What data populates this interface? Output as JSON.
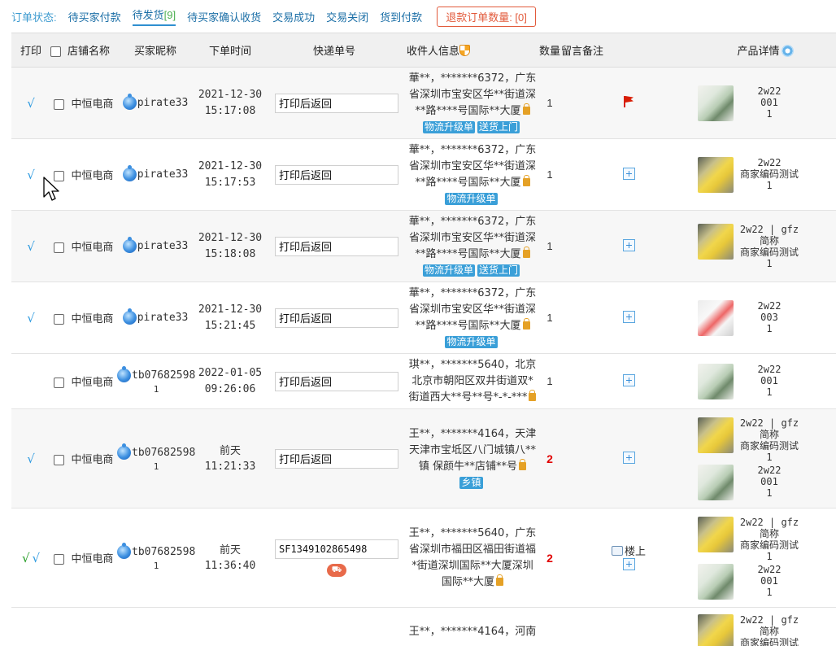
{
  "status_bar": {
    "label": "订单状态:",
    "tabs": [
      {
        "label": "待买家付款",
        "count": ""
      },
      {
        "label": "待发货",
        "count": "[9]"
      },
      {
        "label": "待买家确认收货",
        "count": ""
      },
      {
        "label": "交易成功",
        "count": ""
      },
      {
        "label": "交易关闭",
        "count": ""
      },
      {
        "label": "货到付款",
        "count": ""
      }
    ],
    "refund": "退款订单数量: [0]"
  },
  "columns": {
    "print": "打印",
    "shop": "店铺名称",
    "buyer": "买家昵称",
    "order_time": "下单时间",
    "tracking": "快递单号",
    "recipient": "收件人信息",
    "qty": "数量",
    "note": "留言备注",
    "product": "产品详情"
  },
  "icons": {
    "tick": "✓",
    "lock": "lock-icon",
    "flag": "flag-icon",
    "plus": "plus-icon",
    "memo": "memo-icon",
    "shield": "shield-icon",
    "gear": "gear-icon"
  },
  "colors": {
    "accent": "#2f8fd0",
    "tag_bg": "#3a9fd8",
    "refund": "#e25a3b",
    "qty_red": "#e10000"
  },
  "rows": [
    {
      "print_tick": "√",
      "print_tick2": "",
      "shop": "中恒电商",
      "buyer": "pirate33",
      "buyer_sfx": "",
      "date": "2021-12-30",
      "time": "15:17:08",
      "tracking": "打印后返回",
      "address": "華**，*******6372，广东省深圳市宝安区华**街道深**路****号国际**大厦",
      "tags": [
        "物流升级单",
        "送货上门"
      ],
      "qty": "1",
      "note_icon": "flag",
      "products": [
        {
          "thumb": "green",
          "name": "2w22",
          "code": "001",
          "qty": "1"
        }
      ]
    },
    {
      "print_tick": "√",
      "print_tick2": "",
      "shop": "中恒电商",
      "buyer": "pirate33",
      "buyer_sfx": "",
      "date": "2021-12-30",
      "time": "15:17:53",
      "tracking": "打印后返回",
      "address": "華**，*******6372，广东省深圳市宝安区华**街道深**路****号国际**大厦",
      "tags": [
        "物流升级单"
      ],
      "qty": "1",
      "note_icon": "plus",
      "products": [
        {
          "thumb": "yellow",
          "name": "2w22",
          "code": "商家编码测试",
          "qty": "1"
        }
      ]
    },
    {
      "print_tick": "√",
      "print_tick2": "",
      "shop": "中恒电商",
      "buyer": "pirate33",
      "buyer_sfx": "",
      "date": "2021-12-30",
      "time": "15:18:08",
      "tracking": "打印后返回",
      "address": "華**，*******6372，广东省深圳市宝安区华**街道深**路****号国际**大厦",
      "tags": [
        "物流升级单",
        "送货上门"
      ],
      "qty": "1",
      "note_icon": "plus",
      "products": [
        {
          "thumb": "yellow",
          "name": "2w22 | gfz简称",
          "code": "商家编码测试",
          "qty": "1"
        }
      ]
    },
    {
      "print_tick": "√",
      "print_tick2": "",
      "shop": "中恒电商",
      "buyer": "pirate33",
      "buyer_sfx": "",
      "date": "2021-12-30",
      "time": "15:21:45",
      "tracking": "打印后返回",
      "address": "華**，*******6372，广东省深圳市宝安区华**街道深**路****号国际**大厦",
      "tags": [
        "物流升级单"
      ],
      "qty": "1",
      "note_icon": "plus",
      "products": [
        {
          "thumb": "red",
          "name": "2w22",
          "code": "003",
          "qty": "1"
        }
      ]
    },
    {
      "print_tick": "",
      "print_tick2": "",
      "shop": "中恒电商",
      "buyer": "tb07682598",
      "buyer_sfx": "1",
      "date": "2022-01-05",
      "time": "09:26:06",
      "tracking": "打印后返回",
      "address": "琪**，*******5640，北京北京市朝阳区双井街道双*街道西大**号**号*-*-***",
      "tags": [],
      "qty": "1",
      "note_icon": "plus",
      "products": [
        {
          "thumb": "green",
          "name": "2w22",
          "code": "001",
          "qty": "1"
        }
      ]
    },
    {
      "print_tick": "√",
      "print_tick2": "",
      "shop": "中恒电商",
      "buyer": "tb07682598",
      "buyer_sfx": "1",
      "date": "前天",
      "time": "11:21:33",
      "tracking": "打印后返回",
      "address": "王**，*******4164，天津天津市宝坻区八门城镇八**镇 保颜牛**店铺**号",
      "tags": [
        "乡镇"
      ],
      "qty": "2",
      "note_icon": "plus",
      "products": [
        {
          "thumb": "yellow",
          "name": "2w22 | gfz简称",
          "code": "商家编码测试",
          "qty": "1"
        },
        {
          "thumb": "green",
          "name": "2w22",
          "code": "001",
          "qty": "1"
        }
      ]
    },
    {
      "print_tick": "√",
      "print_tick2": "√",
      "shop": "中恒电商",
      "buyer": "tb07682598",
      "buyer_sfx": "1",
      "date": "前天",
      "time": "11:36:40",
      "tracking": "SF1349102865498",
      "address": "王**，*******5640，广东省深圳市福田区福田街道福*街道深圳国际**大厦深圳国际**大厦",
      "tags": [],
      "qty": "2",
      "note_icon": "memo",
      "note_text": "楼上",
      "products": [
        {
          "thumb": "yellow",
          "name": "2w22 | gfz简称",
          "code": "商家编码测试",
          "qty": "1"
        },
        {
          "thumb": "green",
          "name": "2w22",
          "code": "001",
          "qty": "1"
        }
      ]
    },
    {
      "print_tick": "",
      "print_tick2": "",
      "shop": "",
      "buyer": "",
      "buyer_sfx": "",
      "date": "",
      "time": "",
      "tracking": "",
      "address": "王**，*******4164，河南",
      "tags": [],
      "qty": "",
      "note_icon": "",
      "products": [
        {
          "thumb": "yellow",
          "name": "2w22 | gfz简称",
          "code": "商家编码测试",
          "qty": ""
        }
      ]
    }
  ]
}
